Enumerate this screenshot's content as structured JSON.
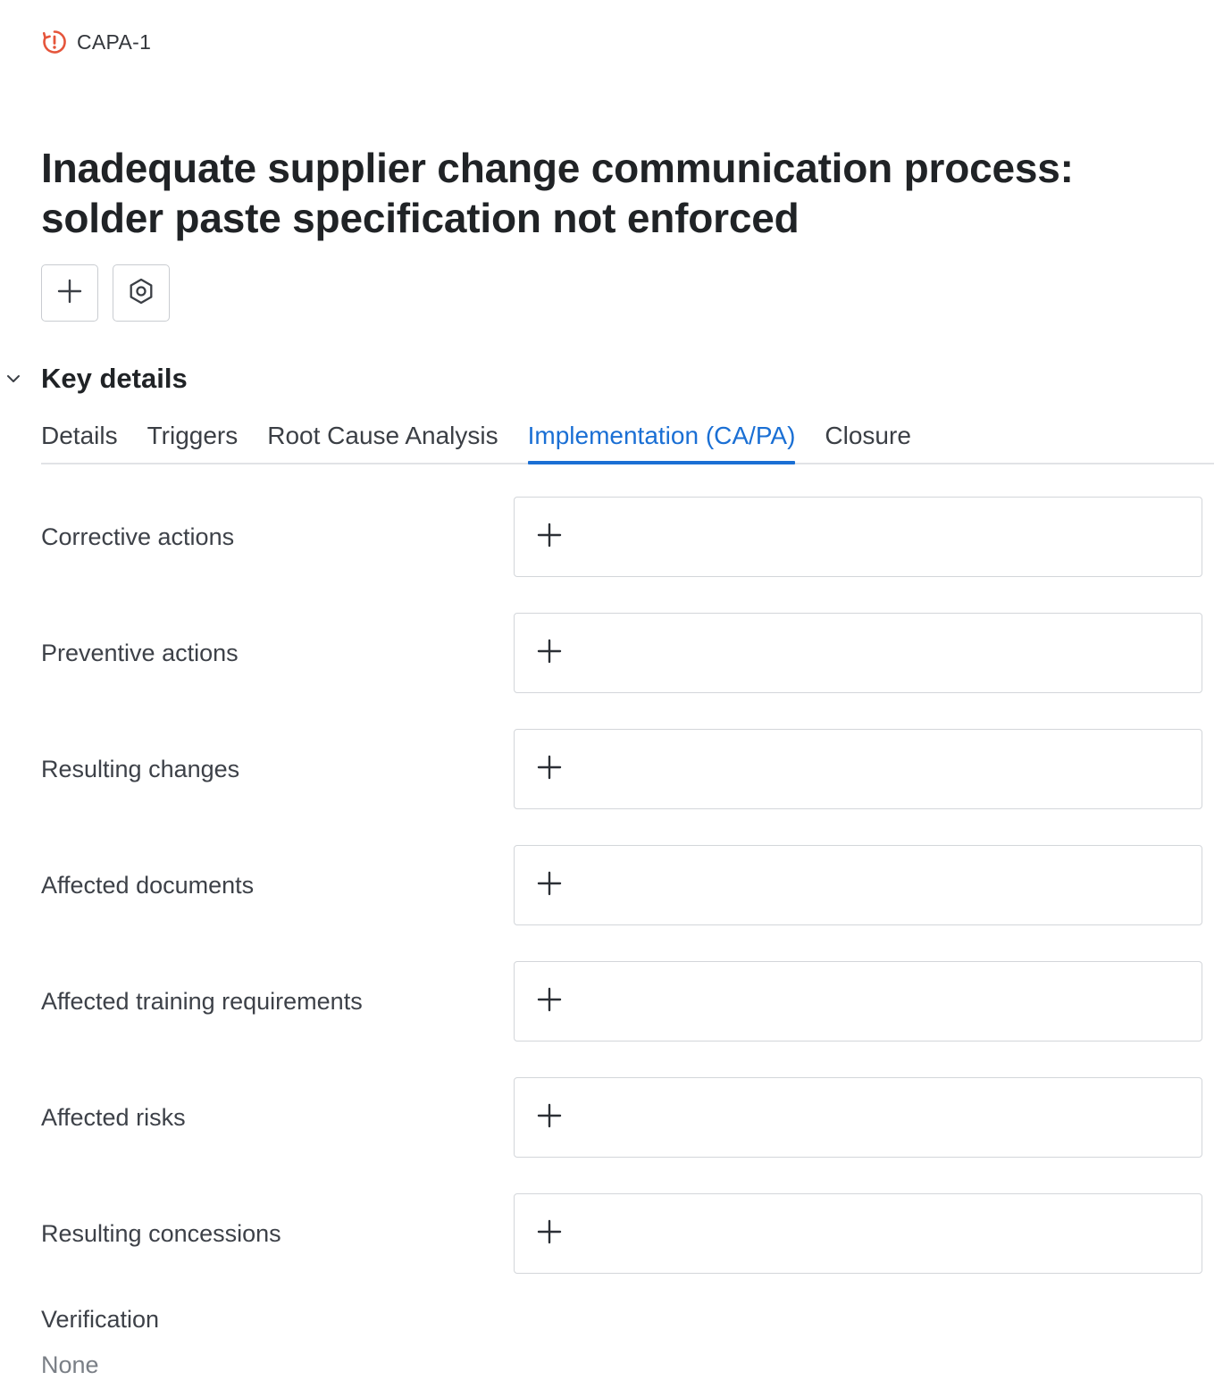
{
  "breadcrumb": {
    "icon": "alert-circle-icon",
    "icon_color": "#e5553b",
    "id_label": "CAPA-1"
  },
  "title_line1": "Inadequate supplier change communication process:",
  "title_line2": "solder paste specification not enforced",
  "toolbar": {
    "add_icon": "plus-icon",
    "settings_icon": "hexagon-settings-icon"
  },
  "section": {
    "title": "Key details",
    "toggle_icon": "chevron-down-icon"
  },
  "tabs": [
    {
      "label": "Details",
      "active": false
    },
    {
      "label": "Triggers",
      "active": false
    },
    {
      "label": "Root Cause Analysis",
      "active": false
    },
    {
      "label": "Implementation (CA/PA)",
      "active": true
    },
    {
      "label": "Closure",
      "active": false
    }
  ],
  "accent_color": "#1a6fd4",
  "fields": [
    {
      "label": "Corrective actions"
    },
    {
      "label": "Preventive actions"
    },
    {
      "label": "Resulting changes"
    },
    {
      "label": "Affected documents"
    },
    {
      "label": "Affected training requirements"
    },
    {
      "label": "Affected risks"
    },
    {
      "label": "Resulting concessions"
    }
  ],
  "verification": {
    "label": "Verification",
    "value": "None"
  }
}
